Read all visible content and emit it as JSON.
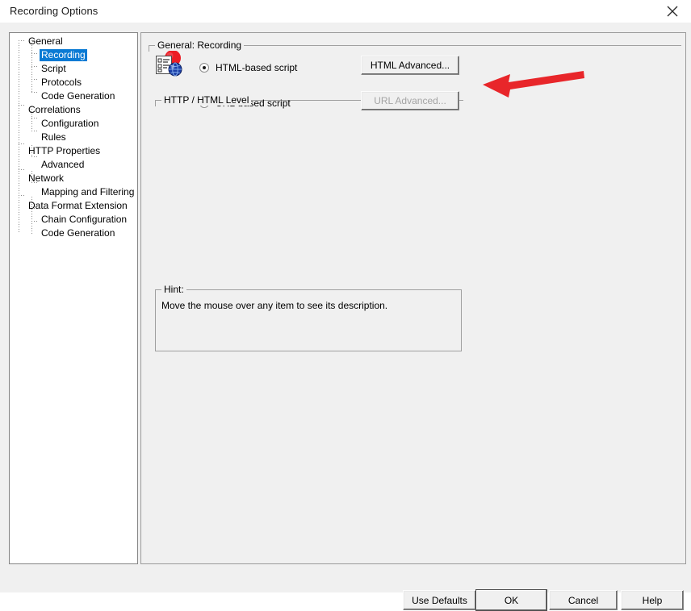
{
  "window": {
    "title": "Recording Options",
    "close_icon": "close-icon"
  },
  "sidebar": {
    "items": [
      {
        "label": "General",
        "level": 0,
        "selected": false
      },
      {
        "label": "Recording",
        "level": 1,
        "selected": true
      },
      {
        "label": "Script",
        "level": 1,
        "selected": false
      },
      {
        "label": "Protocols",
        "level": 1,
        "selected": false
      },
      {
        "label": "Code Generation",
        "level": 1,
        "selected": false
      },
      {
        "label": "Correlations",
        "level": 0,
        "selected": false
      },
      {
        "label": "Configuration",
        "level": 1,
        "selected": false
      },
      {
        "label": "Rules",
        "level": 1,
        "selected": false
      },
      {
        "label": "HTTP Properties",
        "level": 0,
        "selected": false
      },
      {
        "label": "Advanced",
        "level": 1,
        "selected": false
      },
      {
        "label": "Network",
        "level": 0,
        "selected": false
      },
      {
        "label": "Mapping and Filtering",
        "level": 1,
        "selected": false
      },
      {
        "label": "Data Format Extension",
        "level": 0,
        "selected": false
      },
      {
        "label": "Chain Configuration",
        "level": 1,
        "selected": false
      },
      {
        "label": "Code Generation",
        "level": 1,
        "selected": false
      }
    ],
    "selection_color": "#0a7ad4"
  },
  "main": {
    "section_title": "General: Recording",
    "http_group": {
      "title": "HTTP / HTML Level",
      "icon": "html-script-icon",
      "options": [
        {
          "label": "HTML-based script",
          "checked": true
        },
        {
          "label": "URL-based script",
          "checked": false
        }
      ],
      "buttons": [
        {
          "label": "HTML Advanced...",
          "disabled": false
        },
        {
          "label": "URL Advanced...",
          "disabled": true
        }
      ]
    },
    "hint_group": {
      "title": "Hint:",
      "text": "Move the mouse over any item to see its description."
    }
  },
  "footer": {
    "use_defaults_label": "Use Defaults",
    "ok_label": "OK",
    "cancel_label": "Cancel",
    "help_label": "Help"
  },
  "annotation": {
    "name": "red-arrow-pointing-to-html-advanced",
    "color": "#E8262A",
    "direction": "left"
  }
}
